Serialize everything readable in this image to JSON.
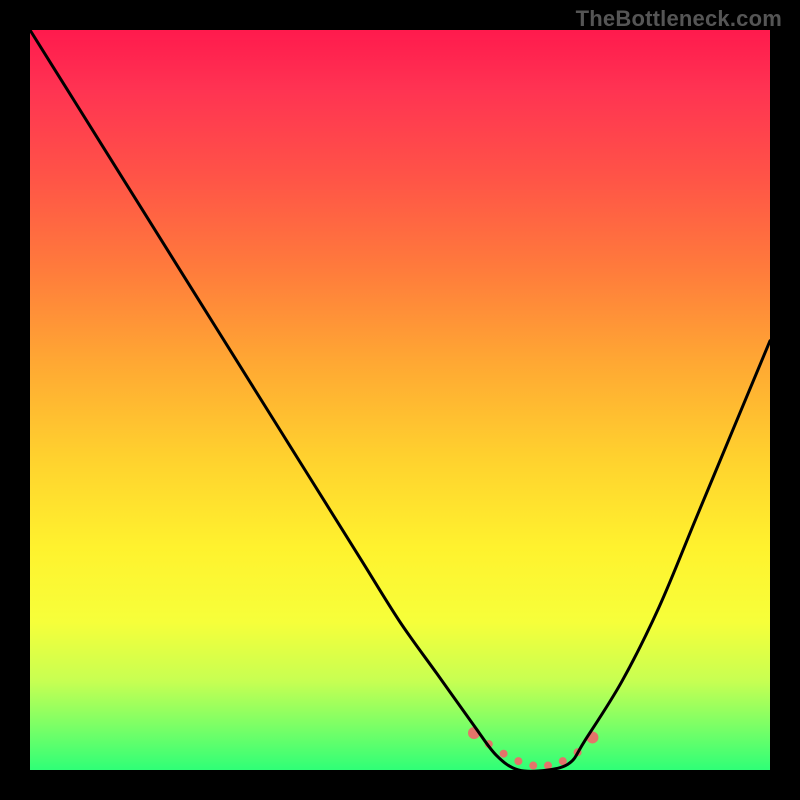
{
  "watermark": "TheBottleneck.com",
  "chart_data": {
    "type": "line",
    "title": "",
    "xlabel": "",
    "ylabel": "",
    "xlim": [
      0,
      100
    ],
    "ylim": [
      0,
      100
    ],
    "series": [
      {
        "name": "bottleneck-curve",
        "x": [
          0,
          5,
          10,
          15,
          20,
          25,
          30,
          35,
          40,
          45,
          50,
          55,
          60,
          63,
          66,
          70,
          73,
          75,
          80,
          85,
          90,
          95,
          100
        ],
        "values": [
          100,
          92,
          84,
          76,
          68,
          60,
          52,
          44,
          36,
          28,
          20,
          13,
          6,
          2,
          0,
          0,
          1,
          4,
          12,
          22,
          34,
          46,
          58
        ]
      }
    ],
    "markers": {
      "name": "optimal-band",
      "x": [
        60,
        62,
        64,
        66,
        68,
        70,
        72,
        74,
        76
      ],
      "values": [
        5,
        3.5,
        2.2,
        1.2,
        0.6,
        0.6,
        1.2,
        2.4,
        4.4
      ],
      "color": "#e4746a"
    },
    "gradient_stops": [
      {
        "pct": 0,
        "color": "#ff1a4d"
      },
      {
        "pct": 50,
        "color": "#ffcc2e"
      },
      {
        "pct": 100,
        "color": "#2fff77"
      }
    ]
  }
}
